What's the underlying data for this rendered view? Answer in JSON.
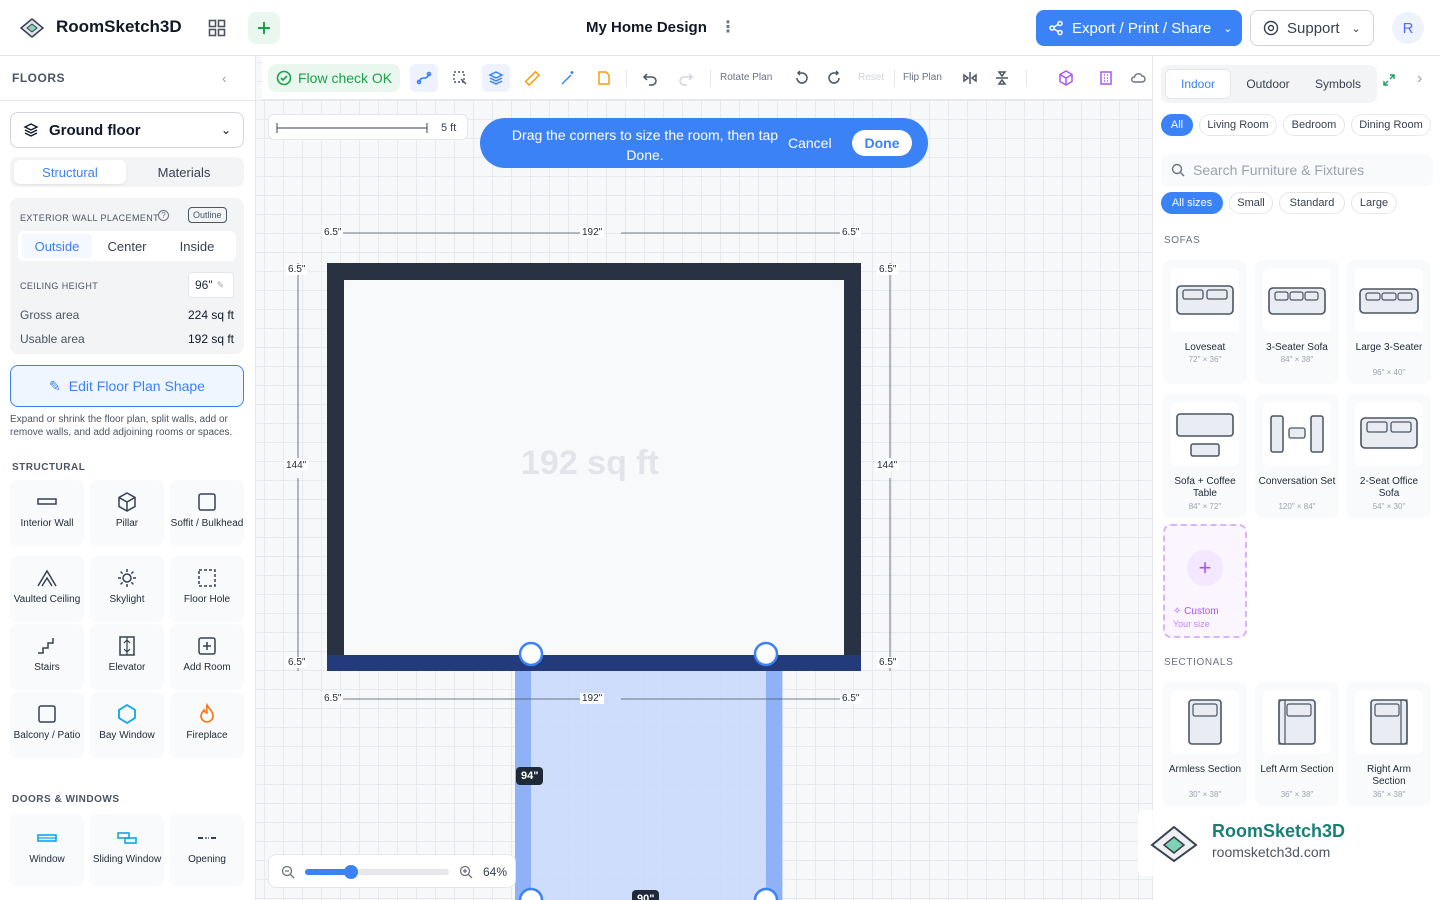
{
  "app": {
    "name": "RoomSketch3D",
    "doc_title": "My Home Design",
    "export_label": "Export / Print / Share",
    "support_label": "Support",
    "avatar_initial": "R"
  },
  "left": {
    "floors_heading": "FLOORS",
    "floor_selected": "Ground floor",
    "tabs": [
      "Structural",
      "Materials"
    ],
    "exterior_label": "EXTERIOR WALL PLACEMENT",
    "exterior_badge": "Outline",
    "placement": [
      "Outside",
      "Center",
      "Inside"
    ],
    "ceiling_label": "CEILING HEIGHT",
    "ceiling_value": "96\"",
    "gross_label": "Gross area",
    "gross_value": "224 sq ft",
    "usable_label": "Usable area",
    "usable_value": "192 sq ft",
    "edit_label": "Edit Floor Plan Shape",
    "help_text": "Expand or shrink the floor plan, split walls, add or remove walls, and add adjoining rooms or spaces.",
    "structural_heading": "STRUCTURAL",
    "structural": [
      "Interior Wall",
      "Pillar",
      "Soffit / Bulkhead",
      "Vaulted Ceiling",
      "Skylight",
      "Floor Hole",
      "Stairs",
      "Elevator",
      "Add Room",
      "Balcony / Patio",
      "Bay Window",
      "Fireplace"
    ],
    "doors_heading": "DOORS & WINDOWS",
    "doors": [
      "Window",
      "Sliding Window",
      "Opening"
    ]
  },
  "toolbar": {
    "flow_label": "Flow check OK",
    "rotate_label": "Rotate Plan",
    "reset_label": "Reset",
    "flip_label": "Flip Plan"
  },
  "canvas": {
    "scale_label": "5 ft",
    "banner_text": "Drag the corners to size the room, then tap Done.",
    "banner_cancel": "Cancel",
    "banner_done": "Done",
    "room_area": "192 sq ft",
    "dims": {
      "top_left": "6.5\"",
      "top_mid": "192\"",
      "top_right": "6.5\"",
      "side_top_l": "6.5\"",
      "side_top_r": "6.5\"",
      "side_l": "144\"",
      "side_r": "144\"",
      "side_bot_l": "6.5\"",
      "side_bot_r": "6.5\"",
      "bot_left": "6.5\"",
      "bot_mid": "192\"",
      "bot_right": "6.5\"",
      "new_height": "94\"",
      "new_width": "90\""
    },
    "zoom_value": "64%"
  },
  "right": {
    "tabs": [
      "Indoor",
      "Outdoor",
      "Symbols"
    ],
    "rooms": [
      "All",
      "Living Room",
      "Bedroom",
      "Dining Room"
    ],
    "search_placeholder": "Search Furniture & Fixtures",
    "sizes": [
      "All sizes",
      "Small",
      "Standard",
      "Large"
    ],
    "sofas_heading": "SOFAS",
    "sofas": [
      {
        "name": "Loveseat",
        "size": "72\" × 36\""
      },
      {
        "name": "3-Seater Sofa",
        "size": "84\" × 38\""
      },
      {
        "name": "Large 3-Seater",
        "size": "96\" × 40\""
      },
      {
        "name": "Sofa + Coffee Table",
        "size": "84\" × 72\""
      },
      {
        "name": "Conversation Set",
        "size": "120\" × 84\""
      },
      {
        "name": "2-Seat Office Sofa",
        "size": "54\" × 30\""
      }
    ],
    "custom_label": "Custom",
    "custom_sub": "Your size",
    "sectionals_heading": "SECTIONALS",
    "sectionals": [
      {
        "name": "Armless Section",
        "size": "30\" × 38\""
      },
      {
        "name": "Left Arm Section",
        "size": "36\" × 38\""
      },
      {
        "name": "Right Arm Section",
        "size": "36\" × 38\""
      }
    ]
  },
  "watermark": {
    "brand": "RoomSketch3D",
    "url": "roomsketch3d.com"
  },
  "colors": {
    "accent": "#3b82f6",
    "wall": "#283242",
    "success": "#16a34a",
    "custom": "#a855f7"
  }
}
